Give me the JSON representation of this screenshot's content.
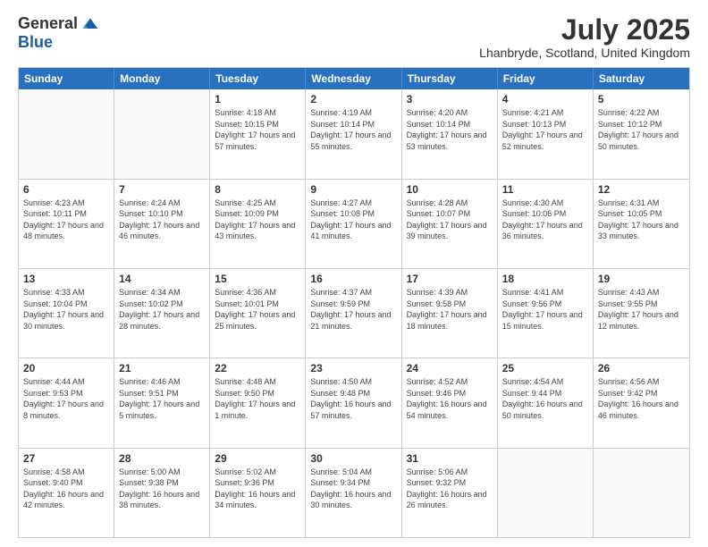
{
  "logo": {
    "general": "General",
    "blue": "Blue"
  },
  "header": {
    "month_title": "July 2025",
    "location": "Lhanbryde, Scotland, United Kingdom"
  },
  "days_of_week": [
    "Sunday",
    "Monday",
    "Tuesday",
    "Wednesday",
    "Thursday",
    "Friday",
    "Saturday"
  ],
  "weeks": [
    [
      {
        "day": "",
        "content": ""
      },
      {
        "day": "",
        "content": ""
      },
      {
        "day": "1",
        "content": "Sunrise: 4:18 AM\nSunset: 10:15 PM\nDaylight: 17 hours and 57 minutes."
      },
      {
        "day": "2",
        "content": "Sunrise: 4:19 AM\nSunset: 10:14 PM\nDaylight: 17 hours and 55 minutes."
      },
      {
        "day": "3",
        "content": "Sunrise: 4:20 AM\nSunset: 10:14 PM\nDaylight: 17 hours and 53 minutes."
      },
      {
        "day": "4",
        "content": "Sunrise: 4:21 AM\nSunset: 10:13 PM\nDaylight: 17 hours and 52 minutes."
      },
      {
        "day": "5",
        "content": "Sunrise: 4:22 AM\nSunset: 10:12 PM\nDaylight: 17 hours and 50 minutes."
      }
    ],
    [
      {
        "day": "6",
        "content": "Sunrise: 4:23 AM\nSunset: 10:11 PM\nDaylight: 17 hours and 48 minutes."
      },
      {
        "day": "7",
        "content": "Sunrise: 4:24 AM\nSunset: 10:10 PM\nDaylight: 17 hours and 46 minutes."
      },
      {
        "day": "8",
        "content": "Sunrise: 4:25 AM\nSunset: 10:09 PM\nDaylight: 17 hours and 43 minutes."
      },
      {
        "day": "9",
        "content": "Sunrise: 4:27 AM\nSunset: 10:08 PM\nDaylight: 17 hours and 41 minutes."
      },
      {
        "day": "10",
        "content": "Sunrise: 4:28 AM\nSunset: 10:07 PM\nDaylight: 17 hours and 39 minutes."
      },
      {
        "day": "11",
        "content": "Sunrise: 4:30 AM\nSunset: 10:06 PM\nDaylight: 17 hours and 36 minutes."
      },
      {
        "day": "12",
        "content": "Sunrise: 4:31 AM\nSunset: 10:05 PM\nDaylight: 17 hours and 33 minutes."
      }
    ],
    [
      {
        "day": "13",
        "content": "Sunrise: 4:33 AM\nSunset: 10:04 PM\nDaylight: 17 hours and 30 minutes."
      },
      {
        "day": "14",
        "content": "Sunrise: 4:34 AM\nSunset: 10:02 PM\nDaylight: 17 hours and 28 minutes."
      },
      {
        "day": "15",
        "content": "Sunrise: 4:36 AM\nSunset: 10:01 PM\nDaylight: 17 hours and 25 minutes."
      },
      {
        "day": "16",
        "content": "Sunrise: 4:37 AM\nSunset: 9:59 PM\nDaylight: 17 hours and 21 minutes."
      },
      {
        "day": "17",
        "content": "Sunrise: 4:39 AM\nSunset: 9:58 PM\nDaylight: 17 hours and 18 minutes."
      },
      {
        "day": "18",
        "content": "Sunrise: 4:41 AM\nSunset: 9:56 PM\nDaylight: 17 hours and 15 minutes."
      },
      {
        "day": "19",
        "content": "Sunrise: 4:43 AM\nSunset: 9:55 PM\nDaylight: 17 hours and 12 minutes."
      }
    ],
    [
      {
        "day": "20",
        "content": "Sunrise: 4:44 AM\nSunset: 9:53 PM\nDaylight: 17 hours and 8 minutes."
      },
      {
        "day": "21",
        "content": "Sunrise: 4:46 AM\nSunset: 9:51 PM\nDaylight: 17 hours and 5 minutes."
      },
      {
        "day": "22",
        "content": "Sunrise: 4:48 AM\nSunset: 9:50 PM\nDaylight: 17 hours and 1 minute."
      },
      {
        "day": "23",
        "content": "Sunrise: 4:50 AM\nSunset: 9:48 PM\nDaylight: 16 hours and 57 minutes."
      },
      {
        "day": "24",
        "content": "Sunrise: 4:52 AM\nSunset: 9:46 PM\nDaylight: 16 hours and 54 minutes."
      },
      {
        "day": "25",
        "content": "Sunrise: 4:54 AM\nSunset: 9:44 PM\nDaylight: 16 hours and 50 minutes."
      },
      {
        "day": "26",
        "content": "Sunrise: 4:56 AM\nSunset: 9:42 PM\nDaylight: 16 hours and 46 minutes."
      }
    ],
    [
      {
        "day": "27",
        "content": "Sunrise: 4:58 AM\nSunset: 9:40 PM\nDaylight: 16 hours and 42 minutes."
      },
      {
        "day": "28",
        "content": "Sunrise: 5:00 AM\nSunset: 9:38 PM\nDaylight: 16 hours and 38 minutes."
      },
      {
        "day": "29",
        "content": "Sunrise: 5:02 AM\nSunset: 9:36 PM\nDaylight: 16 hours and 34 minutes."
      },
      {
        "day": "30",
        "content": "Sunrise: 5:04 AM\nSunset: 9:34 PM\nDaylight: 16 hours and 30 minutes."
      },
      {
        "day": "31",
        "content": "Sunrise: 5:06 AM\nSunset: 9:32 PM\nDaylight: 16 hours and 26 minutes."
      },
      {
        "day": "",
        "content": ""
      },
      {
        "day": "",
        "content": ""
      }
    ]
  ]
}
